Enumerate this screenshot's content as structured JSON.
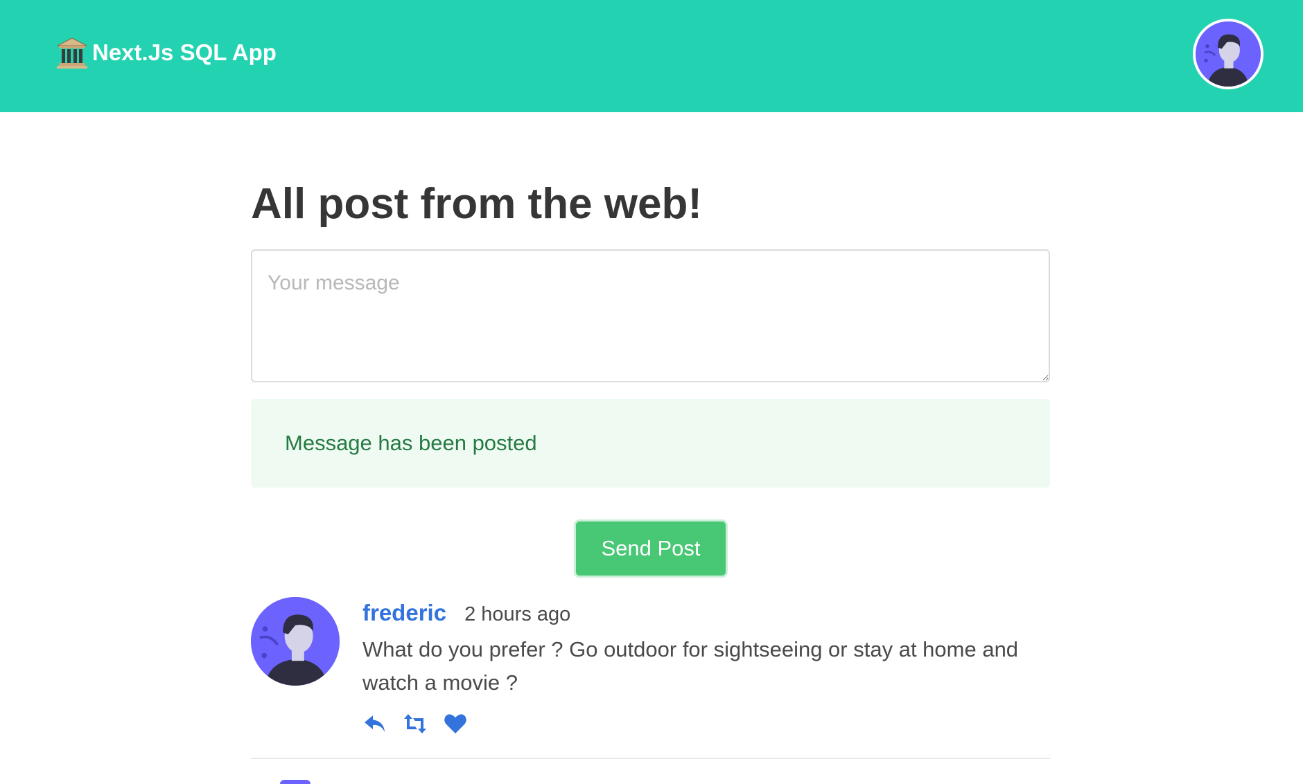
{
  "navbar": {
    "brand_text": "Next.Js SQL App",
    "brand_icon": "classical-building-icon",
    "avatar_icon": "user-avatar-icon",
    "background": "#23d2b0"
  },
  "main": {
    "title": "All post from the web!",
    "message_placeholder": "Your message",
    "message_value": "",
    "notification": "Message has been posted",
    "send_button_label": "Send Post"
  },
  "posts": [
    {
      "author": "frederic",
      "time": "2 hours ago",
      "body": "What do you prefer ? Go outdoor for sightseeing or stay at home and watch a movie ?",
      "actions": [
        "reply-icon",
        "retweet-icon",
        "heart-icon"
      ]
    }
  ],
  "colors": {
    "primary": "#23d2b0",
    "success": "#48c774",
    "success_light": "#effaf3",
    "success_dark": "#257942",
    "link": "#3273dc",
    "avatar_bg": "#6c63ff"
  }
}
